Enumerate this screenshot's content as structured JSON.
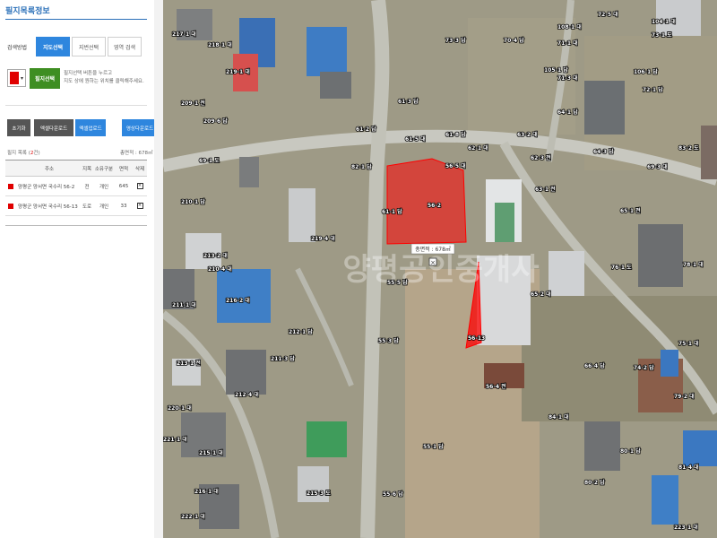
{
  "panel": {
    "title": "필지목록정보",
    "search_method_label": "검색방법",
    "search_tabs": [
      "지도선택",
      "지번선택",
      "영역 검색"
    ],
    "active_tab": 0,
    "parcel_select_button": "필지선택",
    "help_text": [
      "필지선택 버튼을 누르고",
      "지도 상에 원하는 위치를 클릭해주세요."
    ],
    "selected_color": "#e00000",
    "buttons": {
      "reset": "초기화",
      "excel_download": "엑셀다운로드",
      "excel_download_2": "엑셀업로드",
      "map_download": "영상다운로드"
    },
    "count_prefix": "필지 목록 (",
    "count_value": "2",
    "count_suffix": "건)",
    "total_area": "총면적 : 678㎡",
    "table": {
      "headers": [
        "주소",
        "지목",
        "소유구분",
        "면적",
        "삭제"
      ],
      "rows": [
        {
          "address": "양평군 양서면 국수리 56-2",
          "jimok": "전",
          "owner": "개인",
          "area": "645"
        },
        {
          "address": "양평군 양서면 국수리 56-13",
          "jimok": "도로",
          "owner": "개인",
          "area": "33"
        }
      ]
    }
  },
  "map": {
    "measure_label": "총면적 : 678㎡",
    "watermark": "양평공인중개사",
    "highlight_color": "#ff0000",
    "lot_labels": [
      "56-2",
      "56-13",
      "56-4 전",
      "56-5 대",
      "55-5 답",
      "55-1 답",
      "55-3 답",
      "55-6 답",
      "61-1 답",
      "61-2 답",
      "61-3 답",
      "61-5 대",
      "61-8 답",
      "62-1 대",
      "62-3 전",
      "63-1 전",
      "63-2 대",
      "64-1 답",
      "64-3 답",
      "65-1 전",
      "65-2 대",
      "66-4 답",
      "69-1 도",
      "69-3 대",
      "70-4 답",
      "71-1 대",
      "71-3 대",
      "72-1 답",
      "72-5 대",
      "73-1 도",
      "73-3 답",
      "74-2 답",
      "75-1 대",
      "76-1 도",
      "78-1 대",
      "79-2 대",
      "80-1 답",
      "80-2 답",
      "81-4 대",
      "82-1 답",
      "83-2 도",
      "84-1 대",
      "104-1 대",
      "105-1 답",
      "106-1 답",
      "108-1 대",
      "209-1 전",
      "209-6 답",
      "210-1 답",
      "210-4 대",
      "211-1 대",
      "211-3 답",
      "212-1 답",
      "212-4 대",
      "213-1 전",
      "213-2 대",
      "215-1 대",
      "215-3 도",
      "216-1 대",
      "216-2 대",
      "217-1 대",
      "218-1 대",
      "219-1 대",
      "219-4 대",
      "220-1 대",
      "221-1 대",
      "222-1 대",
      "223-1 대"
    ]
  }
}
